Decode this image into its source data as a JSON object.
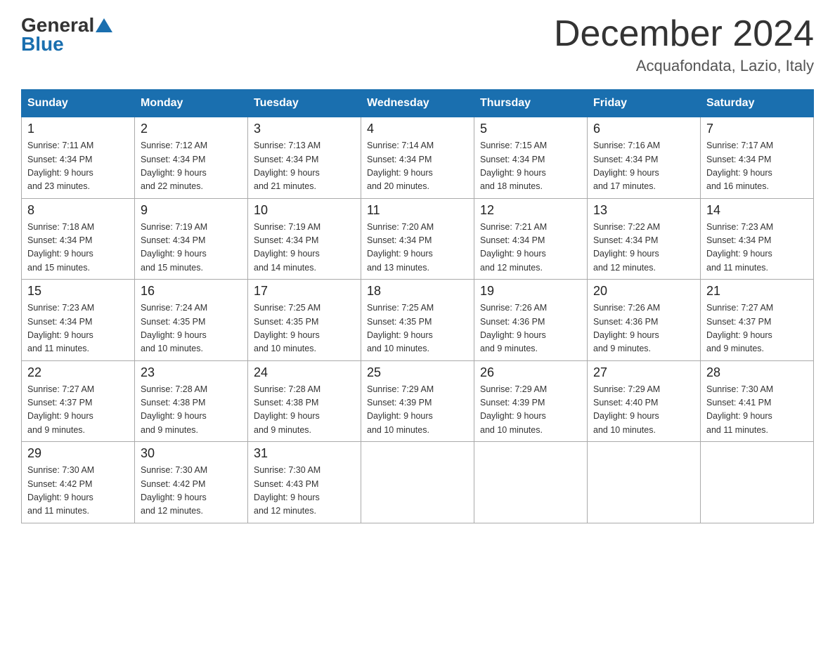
{
  "header": {
    "logo_general": "General",
    "logo_blue": "Blue",
    "month_title": "December 2024",
    "location": "Acquafondata, Lazio, Italy"
  },
  "weekdays": [
    "Sunday",
    "Monday",
    "Tuesday",
    "Wednesday",
    "Thursday",
    "Friday",
    "Saturday"
  ],
  "weeks": [
    [
      {
        "day": "1",
        "sunrise": "7:11 AM",
        "sunset": "4:34 PM",
        "daylight": "9 hours and 23 minutes."
      },
      {
        "day": "2",
        "sunrise": "7:12 AM",
        "sunset": "4:34 PM",
        "daylight": "9 hours and 22 minutes."
      },
      {
        "day": "3",
        "sunrise": "7:13 AM",
        "sunset": "4:34 PM",
        "daylight": "9 hours and 21 minutes."
      },
      {
        "day": "4",
        "sunrise": "7:14 AM",
        "sunset": "4:34 PM",
        "daylight": "9 hours and 20 minutes."
      },
      {
        "day": "5",
        "sunrise": "7:15 AM",
        "sunset": "4:34 PM",
        "daylight": "9 hours and 18 minutes."
      },
      {
        "day": "6",
        "sunrise": "7:16 AM",
        "sunset": "4:34 PM",
        "daylight": "9 hours and 17 minutes."
      },
      {
        "day": "7",
        "sunrise": "7:17 AM",
        "sunset": "4:34 PM",
        "daylight": "9 hours and 16 minutes."
      }
    ],
    [
      {
        "day": "8",
        "sunrise": "7:18 AM",
        "sunset": "4:34 PM",
        "daylight": "9 hours and 15 minutes."
      },
      {
        "day": "9",
        "sunrise": "7:19 AM",
        "sunset": "4:34 PM",
        "daylight": "9 hours and 15 minutes."
      },
      {
        "day": "10",
        "sunrise": "7:19 AM",
        "sunset": "4:34 PM",
        "daylight": "9 hours and 14 minutes."
      },
      {
        "day": "11",
        "sunrise": "7:20 AM",
        "sunset": "4:34 PM",
        "daylight": "9 hours and 13 minutes."
      },
      {
        "day": "12",
        "sunrise": "7:21 AM",
        "sunset": "4:34 PM",
        "daylight": "9 hours and 12 minutes."
      },
      {
        "day": "13",
        "sunrise": "7:22 AM",
        "sunset": "4:34 PM",
        "daylight": "9 hours and 12 minutes."
      },
      {
        "day": "14",
        "sunrise": "7:23 AM",
        "sunset": "4:34 PM",
        "daylight": "9 hours and 11 minutes."
      }
    ],
    [
      {
        "day": "15",
        "sunrise": "7:23 AM",
        "sunset": "4:34 PM",
        "daylight": "9 hours and 11 minutes."
      },
      {
        "day": "16",
        "sunrise": "7:24 AM",
        "sunset": "4:35 PM",
        "daylight": "9 hours and 10 minutes."
      },
      {
        "day": "17",
        "sunrise": "7:25 AM",
        "sunset": "4:35 PM",
        "daylight": "9 hours and 10 minutes."
      },
      {
        "day": "18",
        "sunrise": "7:25 AM",
        "sunset": "4:35 PM",
        "daylight": "9 hours and 10 minutes."
      },
      {
        "day": "19",
        "sunrise": "7:26 AM",
        "sunset": "4:36 PM",
        "daylight": "9 hours and 9 minutes."
      },
      {
        "day": "20",
        "sunrise": "7:26 AM",
        "sunset": "4:36 PM",
        "daylight": "9 hours and 9 minutes."
      },
      {
        "day": "21",
        "sunrise": "7:27 AM",
        "sunset": "4:37 PM",
        "daylight": "9 hours and 9 minutes."
      }
    ],
    [
      {
        "day": "22",
        "sunrise": "7:27 AM",
        "sunset": "4:37 PM",
        "daylight": "9 hours and 9 minutes."
      },
      {
        "day": "23",
        "sunrise": "7:28 AM",
        "sunset": "4:38 PM",
        "daylight": "9 hours and 9 minutes."
      },
      {
        "day": "24",
        "sunrise": "7:28 AM",
        "sunset": "4:38 PM",
        "daylight": "9 hours and 9 minutes."
      },
      {
        "day": "25",
        "sunrise": "7:29 AM",
        "sunset": "4:39 PM",
        "daylight": "9 hours and 10 minutes."
      },
      {
        "day": "26",
        "sunrise": "7:29 AM",
        "sunset": "4:39 PM",
        "daylight": "9 hours and 10 minutes."
      },
      {
        "day": "27",
        "sunrise": "7:29 AM",
        "sunset": "4:40 PM",
        "daylight": "9 hours and 10 minutes."
      },
      {
        "day": "28",
        "sunrise": "7:30 AM",
        "sunset": "4:41 PM",
        "daylight": "9 hours and 11 minutes."
      }
    ],
    [
      {
        "day": "29",
        "sunrise": "7:30 AM",
        "sunset": "4:42 PM",
        "daylight": "9 hours and 11 minutes."
      },
      {
        "day": "30",
        "sunrise": "7:30 AM",
        "sunset": "4:42 PM",
        "daylight": "9 hours and 12 minutes."
      },
      {
        "day": "31",
        "sunrise": "7:30 AM",
        "sunset": "4:43 PM",
        "daylight": "9 hours and 12 minutes."
      },
      null,
      null,
      null,
      null
    ]
  ],
  "labels": {
    "sunrise_prefix": "Sunrise: ",
    "sunset_prefix": "Sunset: ",
    "daylight_prefix": "Daylight: "
  }
}
